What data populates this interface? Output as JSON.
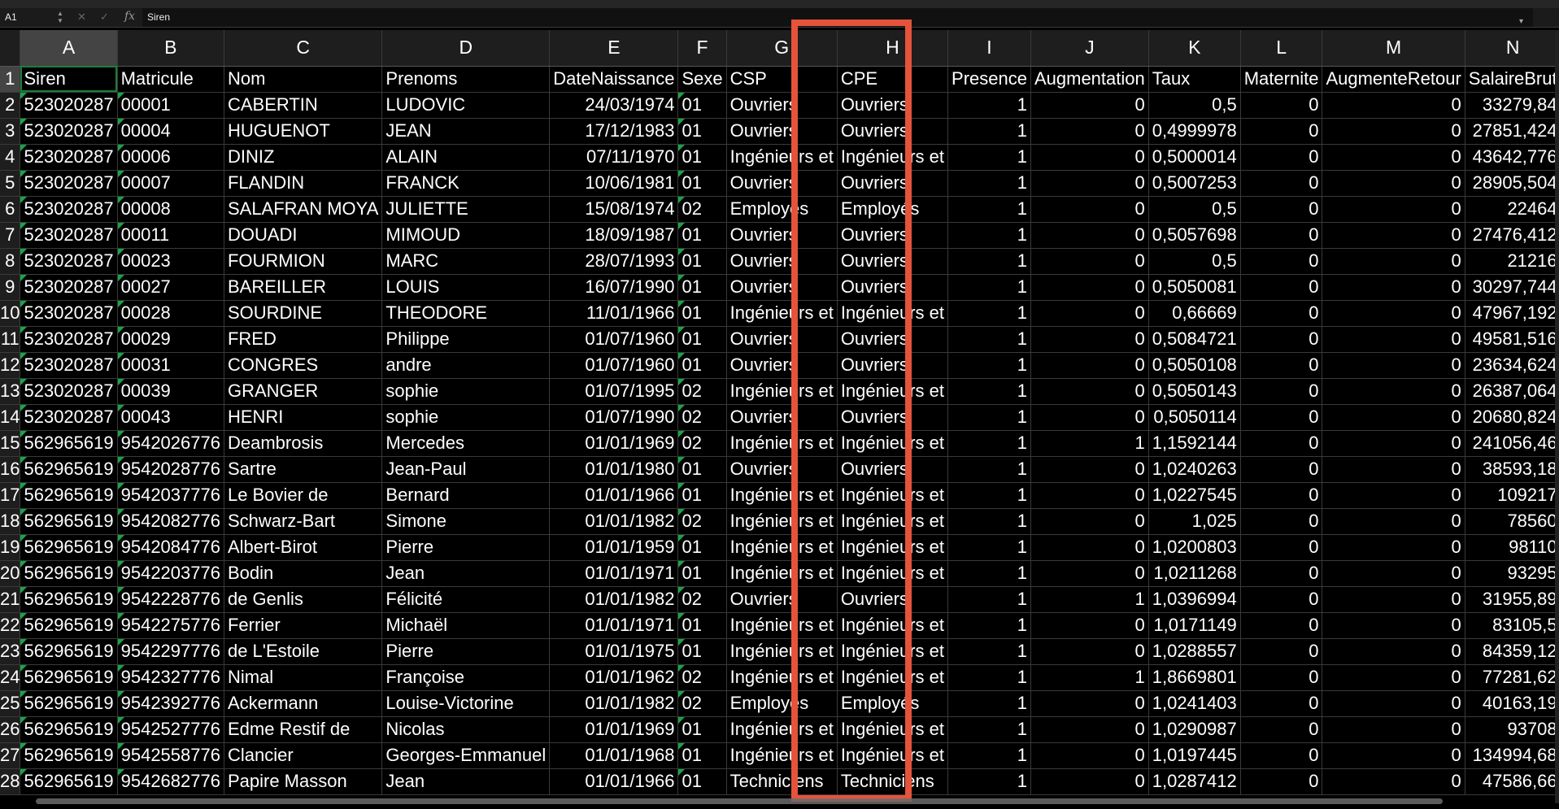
{
  "formula_bar": {
    "cell_ref": "A1",
    "content": "Siren",
    "fx": "fx",
    "cancel": "✕",
    "confirm": "✓",
    "dropdown": "▾"
  },
  "columns": [
    {
      "letter": "A",
      "header": "Siren",
      "type": "num"
    },
    {
      "letter": "B",
      "header": "Matricule",
      "type": "txt"
    },
    {
      "letter": "C",
      "header": "Nom",
      "type": "txt"
    },
    {
      "letter": "D",
      "header": "Prenoms",
      "type": "txt"
    },
    {
      "letter": "E",
      "header": "DateNaissance",
      "type": "num"
    },
    {
      "letter": "F",
      "header": "Sexe",
      "type": "txt"
    },
    {
      "letter": "G",
      "header": "CSP",
      "type": "txt"
    },
    {
      "letter": "H",
      "header": "CPE",
      "type": "txt"
    },
    {
      "letter": "I",
      "header": "Presence",
      "type": "num"
    },
    {
      "letter": "J",
      "header": "Augmentation",
      "type": "num"
    },
    {
      "letter": "K",
      "header": "Taux",
      "type": "num"
    },
    {
      "letter": "L",
      "header": "Maternite",
      "type": "num"
    },
    {
      "letter": "M",
      "header": "AugmenteRetour",
      "type": "num"
    },
    {
      "letter": "N",
      "header": "SalaireBrut",
      "type": "num"
    }
  ],
  "rows": [
    [
      "523020287",
      "00001",
      "CABERTIN",
      "LUDOVIC",
      "24/03/1974",
      "01",
      "Ouvriers",
      "Ouvriers",
      "1",
      "0",
      "0,5",
      "0",
      "0",
      "33279,84"
    ],
    [
      "523020287",
      "00004",
      "HUGUENOT",
      "JEAN",
      "17/12/1983",
      "01",
      "Ouvriers",
      "Ouvriers",
      "1",
      "0",
      "0,4999978",
      "0",
      "0",
      "27851,424"
    ],
    [
      "523020287",
      "00006",
      "DINIZ",
      "ALAIN",
      "07/11/1970",
      "01",
      "Ingénieurs et",
      "Ingénieurs et",
      "1",
      "0",
      "0,5000014",
      "0",
      "0",
      "43642,776"
    ],
    [
      "523020287",
      "00007",
      "FLANDIN",
      "FRANCK",
      "10/06/1981",
      "01",
      "Ouvriers",
      "Ouvriers",
      "1",
      "0",
      "0,5007253",
      "0",
      "0",
      "28905,504"
    ],
    [
      "523020287",
      "00008",
      "SALAFRAN MOYA",
      "JULIETTE",
      "15/08/1974",
      "02",
      "Employés",
      "Employés",
      "1",
      "0",
      "0,5",
      "0",
      "0",
      "22464"
    ],
    [
      "523020287",
      "00011",
      "DOUADI",
      "MIMOUD",
      "18/09/1987",
      "01",
      "Ouvriers",
      "Ouvriers",
      "1",
      "0",
      "0,5057698",
      "0",
      "0",
      "27476,412"
    ],
    [
      "523020287",
      "00023",
      "FOURMION",
      "MARC",
      "28/07/1993",
      "01",
      "Ouvriers",
      "Ouvriers",
      "1",
      "0",
      "0,5",
      "0",
      "0",
      "21216"
    ],
    [
      "523020287",
      "00027",
      "BAREILLER",
      "LOUIS",
      "16/07/1990",
      "01",
      "Ouvriers",
      "Ouvriers",
      "1",
      "0",
      "0,5050081",
      "0",
      "0",
      "30297,744"
    ],
    [
      "523020287",
      "00028",
      "SOURDINE",
      "THEODORE",
      "11/01/1966",
      "01",
      "Ingénieurs et",
      "Ingénieurs et",
      "1",
      "0",
      "0,66669",
      "0",
      "0",
      "47967,192"
    ],
    [
      "523020287",
      "00029",
      "FRED",
      "Philippe",
      "01/07/1960",
      "01",
      "Ouvriers",
      "Ouvriers",
      "1",
      "0",
      "0,5084721",
      "0",
      "0",
      "49581,516"
    ],
    [
      "523020287",
      "00031",
      "CONGRES",
      "andre",
      "01/07/1960",
      "01",
      "Ouvriers",
      "Ouvriers",
      "1",
      "0",
      "0,5050108",
      "0",
      "0",
      "23634,624"
    ],
    [
      "523020287",
      "00039",
      "GRANGER",
      "sophie",
      "01/07/1995",
      "02",
      "Ingénieurs et",
      "Ingénieurs et",
      "1",
      "0",
      "0,5050143",
      "0",
      "0",
      "26387,064"
    ],
    [
      "523020287",
      "00043",
      "HENRI",
      "sophie",
      "01/07/1990",
      "02",
      "Ouvriers",
      "Ouvriers",
      "1",
      "0",
      "0,5050114",
      "0",
      "0",
      "20680,824"
    ],
    [
      "562965619",
      "9542026776",
      "Deambrosis",
      "Mercedes",
      "01/01/1969",
      "02",
      "Ingénieurs et",
      "Ingénieurs et",
      "1",
      "1",
      "1,1592144",
      "0",
      "0",
      "241056,46"
    ],
    [
      "562965619",
      "9542028776",
      "Sartre",
      "Jean-Paul",
      "01/01/1980",
      "01",
      "Ouvriers",
      "Ouvriers",
      "1",
      "0",
      "1,0240263",
      "0",
      "0",
      "38593,18"
    ],
    [
      "562965619",
      "9542037776",
      "Le Bovier de",
      "Bernard",
      "01/01/1966",
      "01",
      "Ingénieurs et",
      "Ingénieurs et",
      "1",
      "0",
      "1,0227545",
      "0",
      "0",
      "109217"
    ],
    [
      "562965619",
      "9542082776",
      "Schwarz-Bart",
      "Simone",
      "01/01/1982",
      "02",
      "Ingénieurs et",
      "Ingénieurs et",
      "1",
      "0",
      "1,025",
      "0",
      "0",
      "78560"
    ],
    [
      "562965619",
      "9542084776",
      "Albert-Birot",
      "Pierre",
      "01/01/1959",
      "01",
      "Ingénieurs et",
      "Ingénieurs et",
      "1",
      "0",
      "1,0200803",
      "0",
      "0",
      "98110"
    ],
    [
      "562965619",
      "9542203776",
      "Bodin",
      "Jean",
      "01/01/1971",
      "01",
      "Ingénieurs et",
      "Ingénieurs et",
      "1",
      "0",
      "1,0211268",
      "0",
      "0",
      "93295"
    ],
    [
      "562965619",
      "9542228776",
      "de Genlis",
      "Félicité",
      "01/01/1982",
      "02",
      "Ouvriers",
      "Ouvriers",
      "1",
      "1",
      "1,0396994",
      "0",
      "0",
      "31955,89"
    ],
    [
      "562965619",
      "9542275776",
      "Ferrier",
      "Michaël",
      "01/01/1971",
      "01",
      "Ingénieurs et",
      "Ingénieurs et",
      "1",
      "0",
      "1,0171149",
      "0",
      "0",
      "83105,5"
    ],
    [
      "562965619",
      "9542297776",
      "de L'Estoile",
      "Pierre",
      "01/01/1975",
      "01",
      "Ingénieurs et",
      "Ingénieurs et",
      "1",
      "0",
      "1,0288557",
      "0",
      "0",
      "84359,12"
    ],
    [
      "562965619",
      "9542327776",
      "Nimal",
      "Françoise",
      "01/01/1962",
      "02",
      "Ingénieurs et",
      "Ingénieurs et",
      "1",
      "1",
      "1,8669801",
      "0",
      "0",
      "77281,62"
    ],
    [
      "562965619",
      "9542392776",
      "Ackermann",
      "Louise-Victorine",
      "01/01/1982",
      "02",
      "Employés",
      "Employés",
      "1",
      "0",
      "1,0241403",
      "0",
      "0",
      "40163,19"
    ],
    [
      "562965619",
      "9542527776",
      "Edme Restif de",
      "Nicolas",
      "01/01/1969",
      "01",
      "Ingénieurs et",
      "Ingénieurs et",
      "1",
      "0",
      "1,0290987",
      "0",
      "0",
      "93708"
    ],
    [
      "562965619",
      "9542558776",
      "Clancier",
      "Georges-Emmanuel",
      "01/01/1968",
      "01",
      "Ingénieurs et",
      "Ingénieurs et",
      "1",
      "0",
      "1,0197445",
      "0",
      "0",
      "134994,68"
    ],
    [
      "562965619",
      "9542682776",
      "Papire Masson",
      "Jean",
      "01/01/1966",
      "01",
      "Techniciens",
      "Techniciens",
      "1",
      "0",
      "1,0287412",
      "0",
      "0",
      "47586,66"
    ]
  ],
  "colors": {
    "highlight": "#e5533b",
    "selection": "#1a7f37",
    "text_marker": "#1aa34a"
  }
}
